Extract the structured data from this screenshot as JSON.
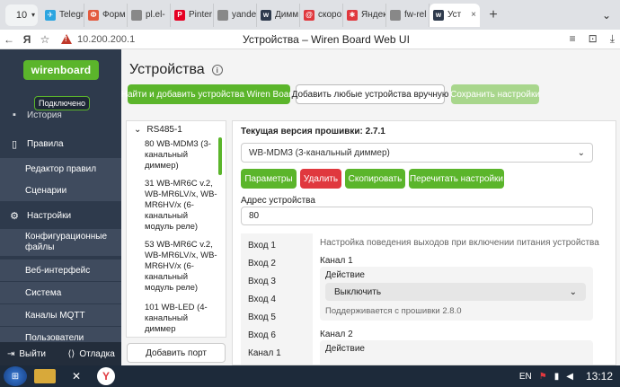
{
  "browser": {
    "tab_counter": "10",
    "tabs": [
      {
        "label": "Telegr",
        "color": "#2ca5e0",
        "glyph": "✈"
      },
      {
        "label": "Форм",
        "color": "#e35b3f",
        "glyph": "Ф"
      },
      {
        "label": "pl.el-",
        "color": "#888888",
        "glyph": ""
      },
      {
        "label": "Pinter",
        "color": "#e60023",
        "glyph": "P"
      },
      {
        "label": "yande",
        "color": "#888888",
        "glyph": ""
      },
      {
        "label": "Димм",
        "color": "#2e3a4c",
        "glyph": "w"
      },
      {
        "label": "скоро",
        "color": "#e0383e",
        "glyph": "@"
      },
      {
        "label": "Яндек",
        "color": "#e0383e",
        "glyph": "✱"
      },
      {
        "label": "fw-rel",
        "color": "#888888",
        "glyph": ""
      },
      {
        "label": "Уст",
        "color": "#2e3a4c",
        "glyph": "w",
        "active": true
      }
    ],
    "address": "10.200.200.1",
    "page_title": "Устройства – Wiren Board Web UI"
  },
  "sidebar": {
    "logo": "wirenboard",
    "status": "Подключено",
    "partial_item": "История",
    "rules_header": "Правила",
    "rules_items": [
      "Редактор правил",
      "Сценарии"
    ],
    "settings_header": "Настройки",
    "settings_items": [
      "Конфигурационные файлы",
      "Веб-интерфейс",
      "Система",
      "Каналы MQTT",
      "Пользователи"
    ],
    "logout": "Выйти",
    "debug": "Отладка"
  },
  "main": {
    "title": "Устройства",
    "buttons": {
      "find_add": "Найти и добавить устройства Wiren Board",
      "add_manual": "Добавить любые устройства вручную",
      "save": "Сохранить настройки"
    },
    "port": "RS485-1",
    "devices": [
      "80 WB-MDM3 (3-канальный диммер)",
      "31 WB-MR6C v.2, WB-MR6LV/x, WB-MR6HV/x (6-канальный модуль реле)",
      "53 WB-MR6C v.2, WB-MR6LV/x, WB-MR6HV/x (6-канальный модуль реле)",
      "101 WB-LED (4-канальный диммер"
    ],
    "add_port": "Добавить порт",
    "panel": {
      "firmware_label": "Текущая версия прошивки: 2.7.1",
      "device_select": "WB-MDM3 (3-канальный диммер)",
      "actions": {
        "params": "Параметры",
        "delete": "Удалить",
        "copy": "Скопировать",
        "reread": "Перечитать настройки"
      },
      "address_label": "Адрес устройства",
      "address_value": "80",
      "inputs": [
        "Вход 1",
        "Вход 2",
        "Вход 3",
        "Вход 4",
        "Вход 5",
        "Вход 6",
        "Канал 1"
      ],
      "section_title": "Настройка поведения выходов при включении питания устройства",
      "channel1": {
        "label": "Канал 1",
        "action_label": "Действие",
        "action_value": "Выключить",
        "note": "Поддерживается с прошивки 2.8.0"
      },
      "channel2": {
        "label": "Канал 2",
        "action_label": "Действие"
      }
    }
  },
  "taskbar": {
    "lang": "EN",
    "clock": "13:12"
  },
  "colors": {
    "accent": "#5bb52b",
    "sidebar_bg": "#2e3a4c",
    "danger": "#e0383e"
  }
}
